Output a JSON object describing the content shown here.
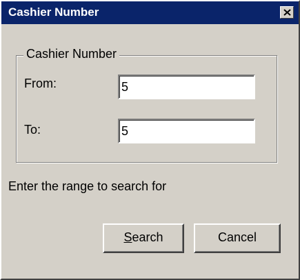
{
  "window": {
    "title": "Cashier Number",
    "close_glyph": "✕"
  },
  "group": {
    "legend": "Cashier Number",
    "from_label": "From:",
    "from_value": "5",
    "to_label": "To:",
    "to_value": "5"
  },
  "hint": "Enter the  range to search for",
  "buttons": {
    "search_mnemonic": "S",
    "search_rest": "earch",
    "cancel_label": "Cancel"
  },
  "colors": {
    "titlebar": "#0a246a",
    "face": "#d4d0c8"
  }
}
